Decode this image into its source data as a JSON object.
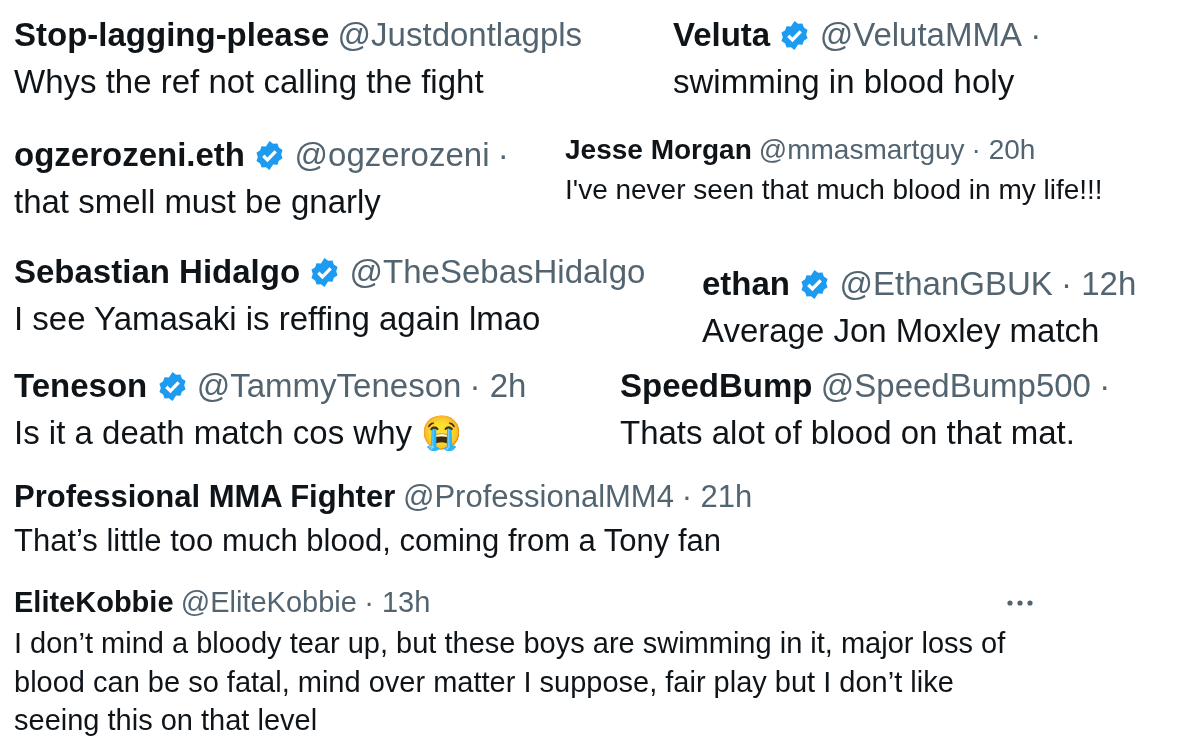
{
  "rows": [
    {
      "tweets": [
        {
          "name": "Stop-lagging-please",
          "verified": false,
          "handle": "@Justdontlagpls",
          "text": "Whys the ref not calling the fight"
        },
        {
          "name": "Veluta",
          "verified": true,
          "handle": "@VelutaMMA",
          "meta": "·",
          "text": "swimming in blood holy"
        }
      ]
    },
    {
      "tweets": [
        {
          "name": "ogzerozeni.eth",
          "verified": true,
          "handle": "@ogzerozeni",
          "meta": "·",
          "text": "that smell must be gnarly"
        },
        {
          "name": "Jesse Morgan",
          "verified": false,
          "handle": "@mmasmartguy",
          "meta": "· 20h",
          "text": "I've never seen that much blood in my life!!!"
        }
      ]
    },
    {
      "tweets": [
        {
          "name": "Sebastian Hidalgo",
          "verified": true,
          "handle": "@TheSebasHidalgo",
          "text": "I see Yamasaki is reffing again lmao"
        },
        {
          "name": "ethan",
          "verified": true,
          "handle": "@EthanGBUK",
          "meta": "· 12h",
          "text": "Average Jon Moxley match"
        }
      ]
    },
    {
      "tweets": [
        {
          "name": "Teneson",
          "verified": true,
          "handle": "@TammyTeneson",
          "meta": "· 2h",
          "text": "Is it a death match cos why 😭"
        },
        {
          "name": "SpeedBump",
          "verified": false,
          "handle": "@SpeedBump500",
          "meta": "·",
          "text": "Thats alot of blood on that mat."
        }
      ]
    },
    {
      "tweets": [
        {
          "name": "Professional MMA Fighter",
          "verified": false,
          "handle": "@ProfessionalMM4",
          "meta": "· 21h",
          "text": "That’s little too much blood, coming from a Tony fan"
        }
      ]
    },
    {
      "tweets": [
        {
          "name": "EliteKobbie",
          "verified": false,
          "handle": "@EliteKobbie",
          "meta": "· 13h",
          "has_menu": true,
          "text": "I don’t mind a bloody tear up, but these boys are swimming in it, major loss of blood can be so fatal, mind over matter I suppose, fair play but I don’t like seeing this on that level"
        }
      ]
    }
  ]
}
